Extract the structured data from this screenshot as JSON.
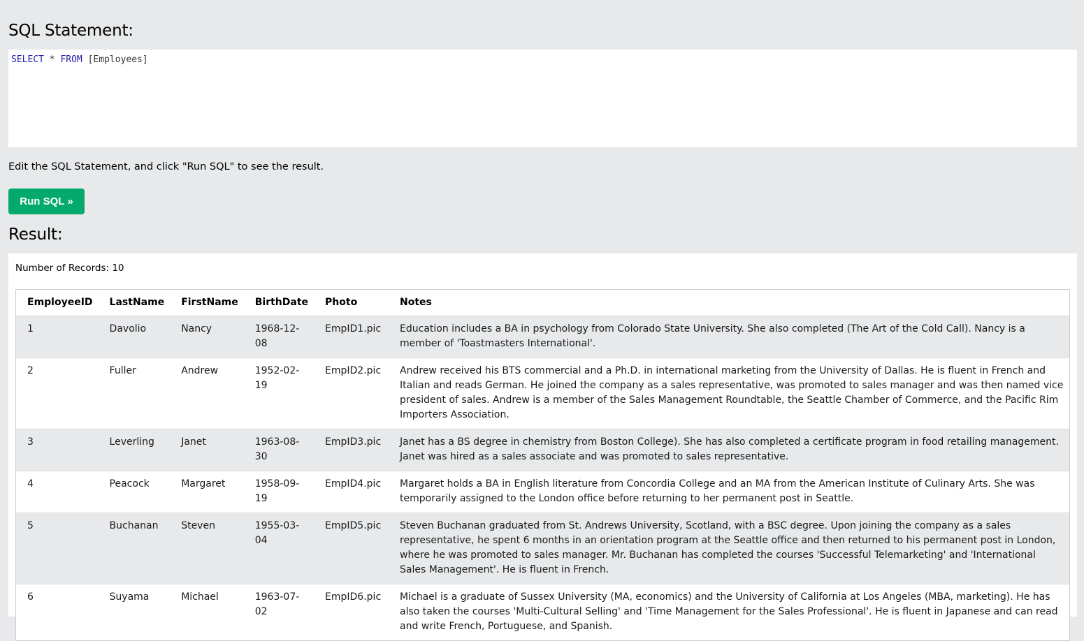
{
  "sql_heading": "SQL Statement:",
  "editor": {
    "keyword1": "SELECT",
    "star": "*",
    "keyword2": "FROM",
    "table": "[Employees]"
  },
  "hint": "Edit the SQL Statement, and click \"Run SQL\" to see the result.",
  "run_button": "Run SQL »",
  "result_heading": "Result:",
  "record_count": "Number of Records: 10",
  "columns": [
    "EmployeeID",
    "LastName",
    "FirstName",
    "BirthDate",
    "Photo",
    "Notes"
  ],
  "rows": [
    {
      "id": "1",
      "last": "Davolio",
      "first": "Nancy",
      "birth": "1968-12-08",
      "photo": "EmpID1.pic",
      "notes": "Education includes a BA in psychology from Colorado State University. She also completed (The Art of the Cold Call). Nancy is a member of 'Toastmasters International'."
    },
    {
      "id": "2",
      "last": "Fuller",
      "first": "Andrew",
      "birth": "1952-02-19",
      "photo": "EmpID2.pic",
      "notes": "Andrew received his BTS commercial and a Ph.D. in international marketing from the University of Dallas. He is fluent in French and Italian and reads German. He joined the company as a sales representative, was promoted to sales manager and was then named vice president of sales. Andrew is a member of the Sales Management Roundtable, the Seattle Chamber of Commerce, and the Pacific Rim Importers Association."
    },
    {
      "id": "3",
      "last": "Leverling",
      "first": "Janet",
      "birth": "1963-08-30",
      "photo": "EmpID3.pic",
      "notes": "Janet has a BS degree in chemistry from Boston College). She has also completed a certificate program in food retailing management. Janet was hired as a sales associate and was promoted to sales representative."
    },
    {
      "id": "4",
      "last": "Peacock",
      "first": "Margaret",
      "birth": "1958-09-19",
      "photo": "EmpID4.pic",
      "notes": "Margaret holds a BA in English literature from Concordia College and an MA from the American Institute of Culinary Arts. She was temporarily assigned to the London office before returning to her permanent post in Seattle."
    },
    {
      "id": "5",
      "last": "Buchanan",
      "first": "Steven",
      "birth": "1955-03-04",
      "photo": "EmpID5.pic",
      "notes": "Steven Buchanan graduated from St. Andrews University, Scotland, with a BSC degree. Upon joining the company as a sales representative, he spent 6 months in an orientation program at the Seattle office and then returned to his permanent post in London, where he was promoted to sales manager. Mr. Buchanan has completed the courses 'Successful Telemarketing' and 'International Sales Management'. He is fluent in French."
    },
    {
      "id": "6",
      "last": "Suyama",
      "first": "Michael",
      "birth": "1963-07-02",
      "photo": "EmpID6.pic",
      "notes": "Michael is a graduate of Sussex University (MA, economics) and the University of California at Los Angeles (MBA, marketing). He has also taken the courses 'Multi-Cultural Selling' and 'Time Management for the Sales Professional'. He is fluent in Japanese and can read and write French, Portuguese, and Spanish."
    }
  ]
}
